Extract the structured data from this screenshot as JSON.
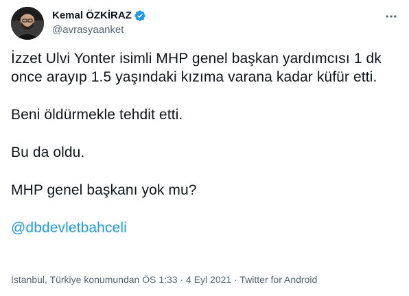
{
  "author": {
    "display_name": "Kemal ÖZKİRAZ",
    "handle": "@avrasyaanket",
    "verified_icon": "verified-badge-icon",
    "avatar_icon": "user-avatar"
  },
  "menu": {
    "more_icon": "more-options-icon"
  },
  "tweet": {
    "paragraph_1": "İzzet Ulvi Yonter isimli MHP genel başkan yardımcısı 1 dk once arayıp 1.5 yaşındaki kızıma varana kadar küfür etti.",
    "paragraph_2": "Beni öldürmekle tehdit etti.",
    "paragraph_3": "Bu da oldu.",
    "paragraph_4": "MHP genel başkanı yok mu?",
    "mention": "@dbdevletbahceli"
  },
  "meta": {
    "location": "İstanbul, Türkiye konumundan",
    "time": "ÖS 1:33",
    "separator": "·",
    "date": "4 Eyl 2021",
    "source": "Twitter for Android"
  },
  "colors": {
    "link": "#1d9bf0",
    "secondary_text": "#536471",
    "primary_text": "#0f1419"
  }
}
